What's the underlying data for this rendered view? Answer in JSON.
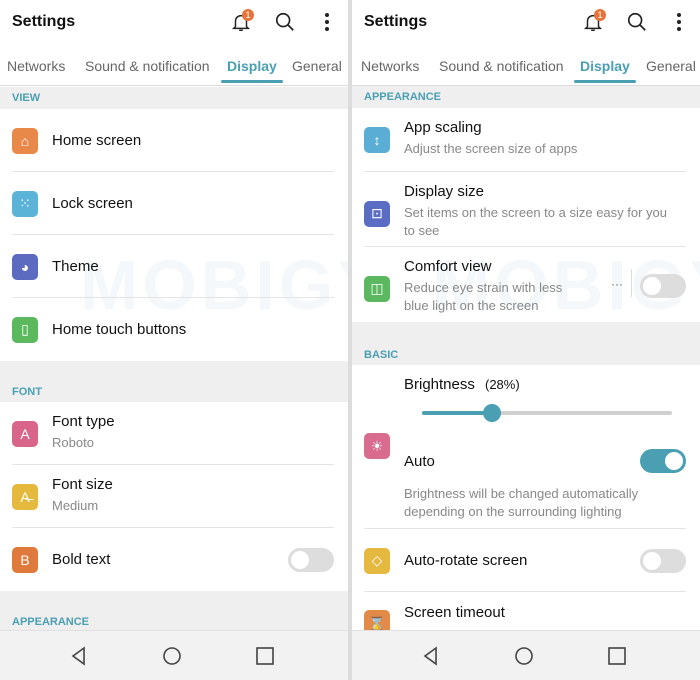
{
  "accent": "#4a9fb3",
  "watermark": "MOBIGYAAN",
  "panels": [
    {
      "title": "Settings",
      "notification_count": "1",
      "tabs": [
        {
          "label": "Networks"
        },
        {
          "label": "Sound & notification"
        },
        {
          "label": "Display",
          "active": true
        },
        {
          "label": "General"
        }
      ],
      "blocks": [
        {
          "type": "section",
          "label": "VIEW"
        },
        {
          "type": "item",
          "label": "Home screen",
          "icon": "home-icon",
          "color": "#e8894a"
        },
        {
          "type": "item",
          "label": "Lock screen",
          "icon": "lock-screen-icon",
          "color": "#5bb3d8"
        },
        {
          "type": "item",
          "label": "Theme",
          "icon": "palette-icon",
          "color": "#5c6bc0"
        },
        {
          "type": "item",
          "label": "Home touch buttons",
          "icon": "touch-buttons-icon",
          "color": "#5cb85c",
          "last": true
        },
        {
          "type": "section",
          "label": "FONT"
        },
        {
          "type": "item",
          "label": "Font type",
          "sub": "Roboto",
          "icon": "font-type-icon",
          "color": "#d9668a"
        },
        {
          "type": "item",
          "label": "Font size",
          "sub": "Medium",
          "icon": "font-size-icon",
          "color": "#e5b93e"
        },
        {
          "type": "item",
          "label": "Bold text",
          "icon": "bold-icon",
          "color": "#e07a3c",
          "toggle": false,
          "last": true
        },
        {
          "type": "section",
          "label": "APPEARANCE"
        }
      ]
    },
    {
      "title": "Settings",
      "notification_count": "1",
      "tabs": [
        {
          "label": "Networks"
        },
        {
          "label": "Sound & notification"
        },
        {
          "label": "Display",
          "active": true
        },
        {
          "label": "General"
        }
      ],
      "blocks": [
        {
          "type": "section",
          "label": "APPEARANCE"
        },
        {
          "type": "item",
          "label": "App scaling",
          "sub": "Adjust the screen size of apps",
          "icon": "app-scaling-icon",
          "color": "#5aaed6"
        },
        {
          "type": "item",
          "label": "Display size",
          "sub": "Set items on the screen to a size easy for you to see",
          "icon": "display-size-icon",
          "color": "#5b6cc4"
        },
        {
          "type": "item",
          "label": "Comfort view",
          "sub": "Reduce eye strain with less blue light on the screen",
          "icon": "comfort-view-icon",
          "color": "#5cb860",
          "toggle": false,
          "more": true,
          "last": true
        },
        {
          "type": "section",
          "label": "BASIC"
        },
        {
          "type": "brightness",
          "label": "Brightness",
          "value_label": "(28%)",
          "value": 28,
          "auto_label": "Auto",
          "auto": true,
          "auto_sub": "Brightness will be changed automatically depending on the surrounding lighting",
          "icon": "brightness-icon",
          "color": "#d96b8f"
        },
        {
          "type": "item",
          "label": "Auto-rotate screen",
          "icon": "auto-rotate-icon",
          "color": "#e5b840",
          "toggle": false
        },
        {
          "type": "item",
          "label": "Screen timeout",
          "icon": "screen-timeout-icon",
          "color": "#e38a48",
          "last": true
        }
      ]
    }
  ]
}
